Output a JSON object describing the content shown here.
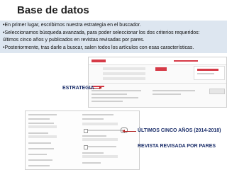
{
  "slide": {
    "title": "Base de datos",
    "bullets": [
      "•En primer lugar, escribimos nuestra estrategia en el buscador.",
      "•Seleccionamos búsqueda avanzada, para poder seleccionar los dos criterios requeridos:",
      "últimos cinco años y publicados en revistas revisadas por pares.",
      "•Posteriormente, tras darle a buscar, salen todos los artículos con esas características."
    ],
    "labels": {
      "strategy": "ESTRATEGIA",
      "last_five_years": "ÚLTIMOS CINCO AÑOS (2014-2018)",
      "peer_reviewed": "REVISTA REVISADA POR PARES"
    }
  },
  "screenshot1": {
    "search_button": "Buscar"
  },
  "colors": {
    "banner": "#dde6f0",
    "accent": "#d63a47",
    "label": "#1b2e6a"
  }
}
